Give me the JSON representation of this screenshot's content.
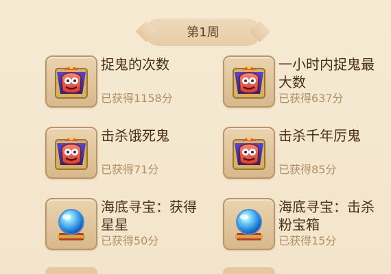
{
  "week": {
    "title": "第1周"
  },
  "tasks": [
    {
      "title": "捉鬼的次数",
      "score": "已获得1158分",
      "icon": "ghost-mask-icon"
    },
    {
      "title": "一小时内捉鬼最大数",
      "score": "已获得637分",
      "icon": "ghost-mask-icon"
    },
    {
      "title": "击杀饿死鬼",
      "score": "已获得71分",
      "icon": "ghost-mask-icon"
    },
    {
      "title": "击杀千年厉鬼",
      "score": "已获得85分",
      "icon": "ghost-mask-icon"
    },
    {
      "title": "海底寻宝：获得星星",
      "score": "已获得50分",
      "icon": "crystal-ball-icon"
    },
    {
      "title": "海底寻宝：击杀粉宝箱",
      "score": "已获得15分",
      "icon": "crystal-ball-icon"
    }
  ],
  "colors": {
    "background": "#f3e5cb",
    "title_text": "#4a2f18",
    "score_text": "#b18e67"
  }
}
